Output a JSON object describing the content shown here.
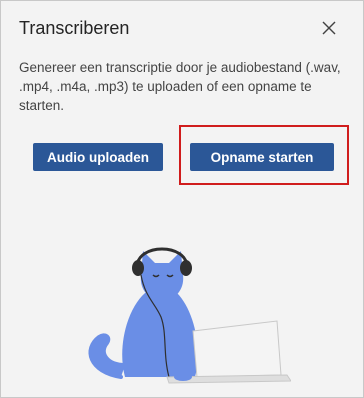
{
  "panel": {
    "title": "Transcriberen",
    "close_icon": "close-icon"
  },
  "description": "Genereer een transcriptie door je audiobestand (.wav, .mp4, .m4a, .mp3) te uploaden of een opname te starten.",
  "buttons": {
    "upload_label": "Audio uploaden",
    "record_label": "Opname starten"
  },
  "colors": {
    "button_bg": "#2b5797",
    "highlight": "#d01c1c",
    "panel_bg": "#f3f3f3"
  }
}
